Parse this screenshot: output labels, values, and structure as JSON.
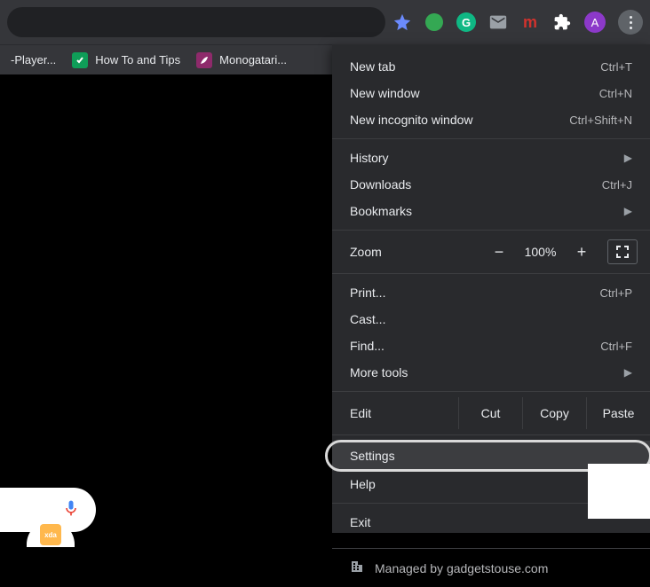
{
  "toolbar": {
    "avatar_initial": "A",
    "m_label": "m",
    "g_label": "G"
  },
  "bookmarks": [
    {
      "label": "-Player..."
    },
    {
      "label": "How To and Tips"
    },
    {
      "label": "Monogatari..."
    }
  ],
  "xda_label": "xda",
  "menu": {
    "new_tab": {
      "label": "New tab",
      "shortcut": "Ctrl+T"
    },
    "new_window": {
      "label": "New window",
      "shortcut": "Ctrl+N"
    },
    "new_incognito": {
      "label": "New incognito window",
      "shortcut": "Ctrl+Shift+N"
    },
    "history": {
      "label": "History"
    },
    "downloads": {
      "label": "Downloads",
      "shortcut": "Ctrl+J"
    },
    "bookmarks": {
      "label": "Bookmarks"
    },
    "zoom": {
      "label": "Zoom",
      "value": "100%",
      "minus": "−",
      "plus": "+"
    },
    "print": {
      "label": "Print...",
      "shortcut": "Ctrl+P"
    },
    "cast": {
      "label": "Cast..."
    },
    "find": {
      "label": "Find...",
      "shortcut": "Ctrl+F"
    },
    "more_tools": {
      "label": "More tools"
    },
    "edit": {
      "label": "Edit",
      "cut": "Cut",
      "copy": "Copy",
      "paste": "Paste"
    },
    "settings": {
      "label": "Settings"
    },
    "help": {
      "label": "Help"
    },
    "exit": {
      "label": "Exit"
    },
    "managed": {
      "label": "Managed by gadgetstouse.com"
    }
  }
}
